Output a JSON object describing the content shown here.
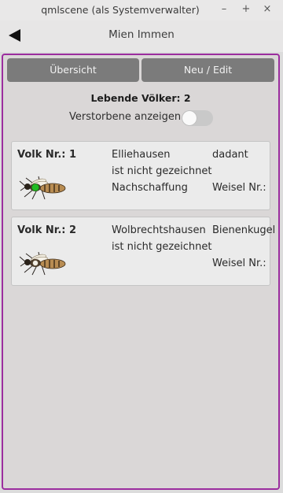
{
  "window": {
    "title": "qmlscene (als Systemverwalter)",
    "minimize_symbol": "–",
    "maximize_symbol": "+",
    "close_symbol": "×"
  },
  "header": {
    "back_icon": "back-arrow-icon",
    "title": "Mien Immen"
  },
  "tabs": {
    "overview": "Übersicht",
    "edit": "Neu / Edit"
  },
  "summary": {
    "live_label": "Lebende Völker: 2",
    "show_deceased_label": "Verstorbene anzeigen",
    "show_deceased_on": false
  },
  "colonies": [
    {
      "nr_label": "Volk Nr.: 1",
      "location": "Elliehausen",
      "hive_type": "dadant",
      "marking": "ist nicht gezeichnet",
      "origin": "Nachschaffung",
      "queen_label": "Weisel Nr.:",
      "queen_marked_color": "#22bb22"
    },
    {
      "nr_label": "Volk Nr.: 2",
      "location": "Wolbrechtshausen",
      "hive_type": "Bienenkugel",
      "marking": "ist nicht gezeichnet",
      "origin": "",
      "queen_label": "Weisel Nr.:",
      "queen_marked_color": ""
    }
  ],
  "colors": {
    "frame_border": "#9b2d9e",
    "tab_background": "#7b7b7b"
  }
}
